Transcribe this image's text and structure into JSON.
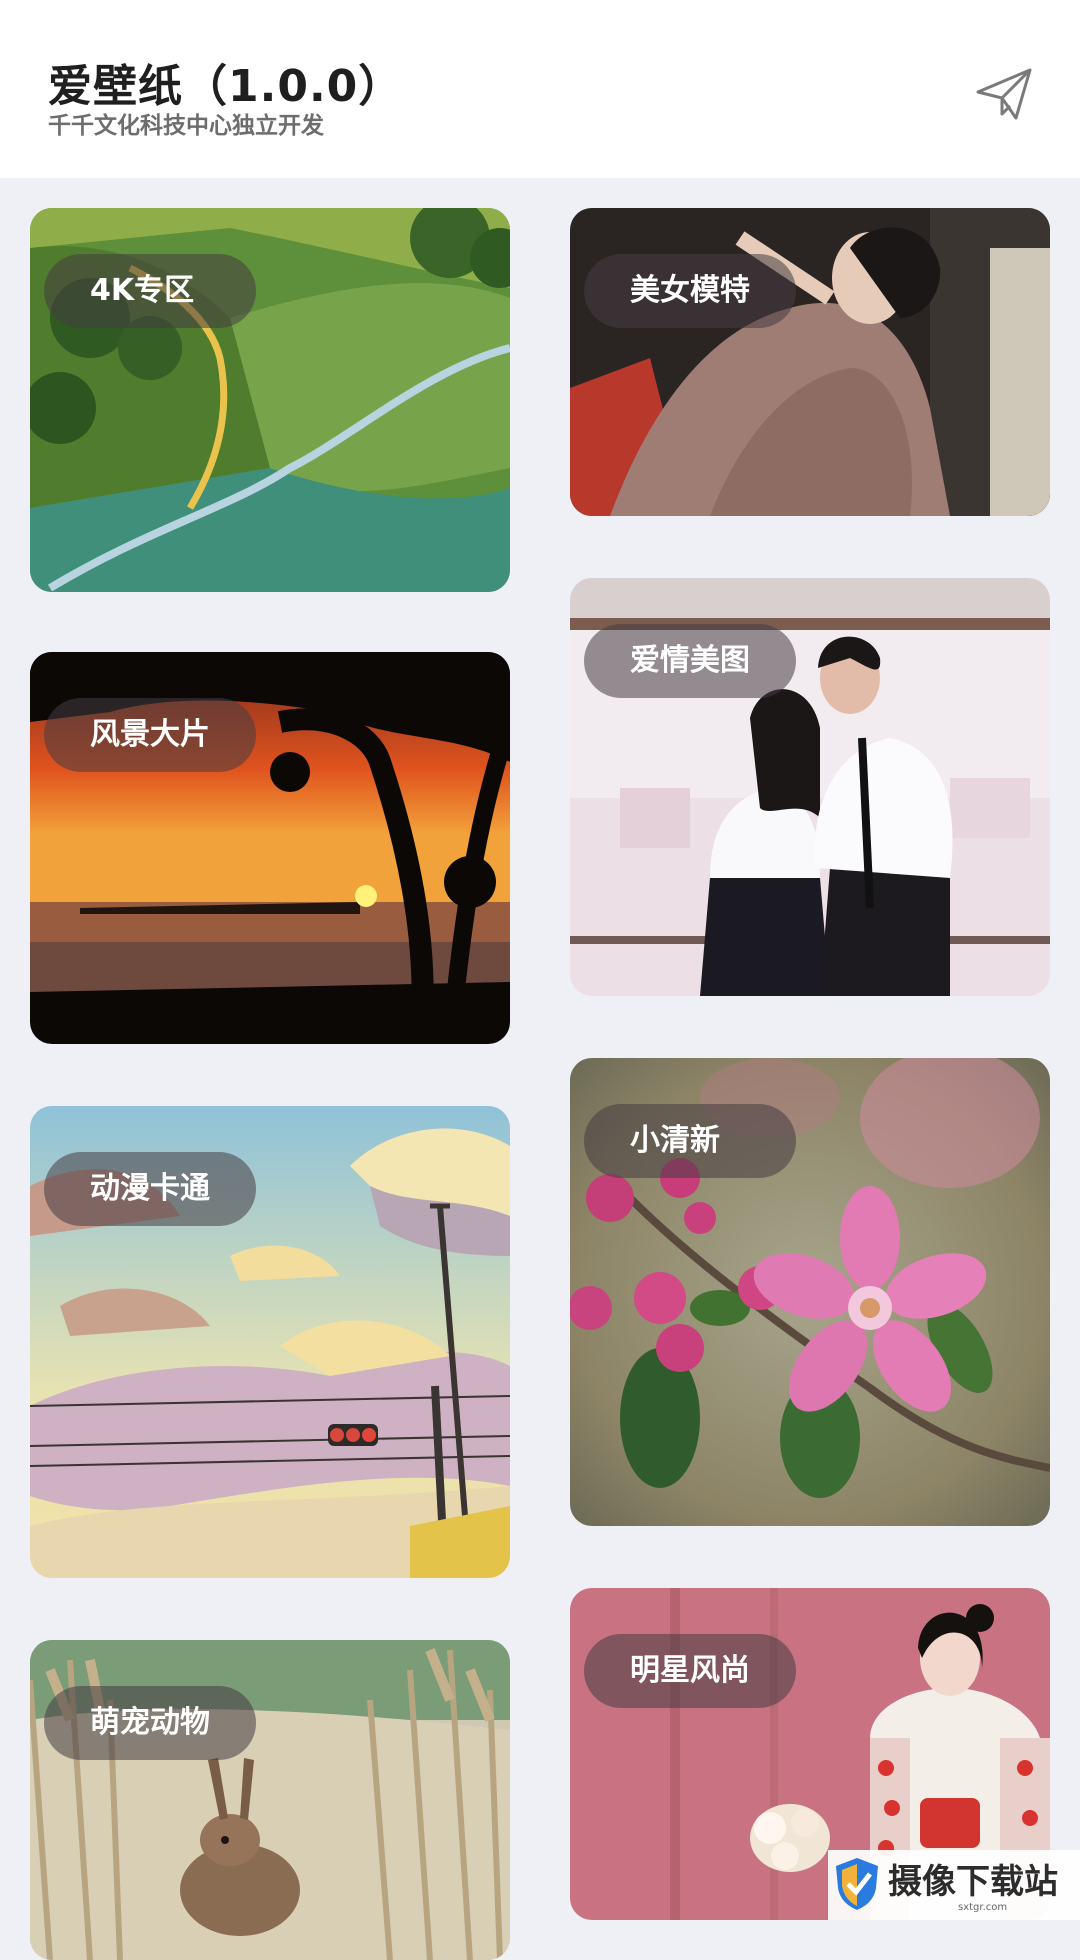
{
  "header": {
    "title": "爱壁纸（1.0.0）",
    "subtitle": "千千文化科技中心独立开发",
    "share_icon": "paper-plane-icon"
  },
  "categories": [
    {
      "label": "4K专区"
    },
    {
      "label": "美女模特"
    },
    {
      "label": "风景大片"
    },
    {
      "label": "爱情美图"
    },
    {
      "label": "动漫卡通"
    },
    {
      "label": "小清新"
    },
    {
      "label": "萌宠动物"
    },
    {
      "label": "明星风尚"
    }
  ],
  "watermark": {
    "text": "摄像下载站",
    "url": "sxtgr.com"
  },
  "colors": {
    "background": "#efeff6",
    "header_bg": "#ffffff",
    "label_bg": "rgba(70,60,65,0.55)"
  }
}
